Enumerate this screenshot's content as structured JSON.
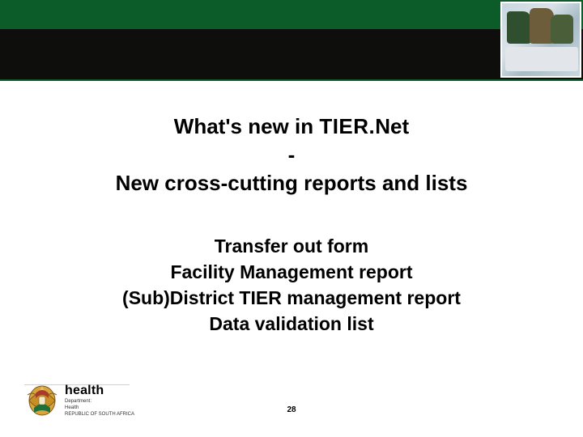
{
  "header": {
    "brand_bar_color": "#0c5c2a",
    "dark_bar_color": "#0e0f0d"
  },
  "title": {
    "prefix": "What's new in ",
    "tier": "TIER.",
    "net": "Net",
    "dash": "-",
    "line2": "New cross-cutting reports and lists"
  },
  "items": [
    "Transfer out form",
    "Facility Management report",
    "(Sub)District TIER management report",
    "Data validation list"
  ],
  "footer": {
    "health": "health",
    "line1": "Department:",
    "line2": "Health",
    "line3": "REPUBLIC OF SOUTH AFRICA"
  },
  "page_number": "28"
}
